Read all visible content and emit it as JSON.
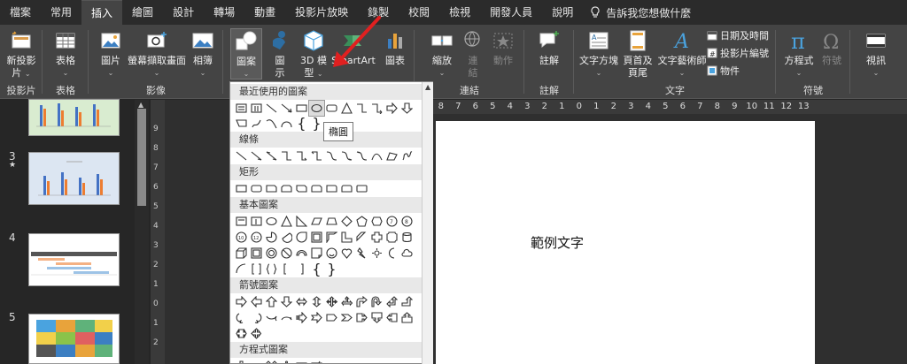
{
  "menu": {
    "tabs": [
      "檔案",
      "常用",
      "插入",
      "繪圖",
      "設計",
      "轉場",
      "動畫",
      "投影片放映",
      "錄製",
      "校閱",
      "檢視",
      "開發人員",
      "說明"
    ],
    "active": "插入",
    "tell_me": "告訴我您想做什麼"
  },
  "ribbon": {
    "groups": {
      "slides": "投影片",
      "tables": "表格",
      "images": "影像",
      "links": "連結",
      "comments": "註解",
      "text": "文字",
      "symbols": "符號"
    },
    "buttons": {
      "new_slide_1": "新投影",
      "new_slide_2": "片",
      "table": "表格",
      "pictures": "圖片",
      "screenshot": "螢幕擷取畫面",
      "album": "相簿",
      "shapes": "圖案",
      "icons_1": "圖",
      "icons_2": "示",
      "model_1": "3D 模",
      "model_2": "型",
      "smartart": "SmartArt",
      "chart": "圖表",
      "zoom": "縮放",
      "link_1": "連",
      "link_2": "結",
      "action": "動作",
      "comment": "註解",
      "textbox": "文字方塊",
      "header_1": "頁首及",
      "header_2": "頁尾",
      "wordart": "文字藝術師",
      "datetime": "日期及時間",
      "slide_number": "投影片編號",
      "object": "物件",
      "equation": "方程式",
      "symbol": "符號",
      "video": "視訊"
    }
  },
  "slides_pane": {
    "numbers": [
      "3",
      "4",
      "5"
    ],
    "star": "★"
  },
  "vertical_ruler": [
    "9",
    "8",
    "7",
    "6",
    "5",
    "4",
    "3",
    "2",
    "1",
    "0",
    "1",
    "2"
  ],
  "horizontal_ruler": [
    "8",
    "7",
    "6",
    "5",
    "4",
    "3",
    "2",
    "1",
    "0",
    "1",
    "2",
    "3",
    "4",
    "5",
    "6",
    "7",
    "8",
    "9",
    "10",
    "11",
    "12",
    "13"
  ],
  "slide": {
    "sample_text": "範例文字"
  },
  "dropdown": {
    "categories": {
      "recent": "最近使用的圖案",
      "lines": "線條",
      "rectangles": "矩形",
      "basic": "基本圖案",
      "arrows": "箭號圖案",
      "equation": "方程式圖案"
    },
    "tooltip": "橢圓",
    "braces_1": "{",
    "braces_2": "}"
  },
  "colors": {
    "accent": "#e02020",
    "ribbon": "#444444"
  }
}
